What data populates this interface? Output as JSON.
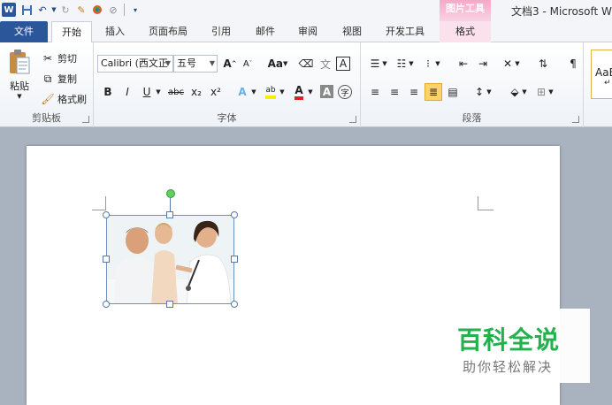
{
  "window": {
    "context_header": "图片工具",
    "title": "文档3 - Microsoft W"
  },
  "qat": {
    "logo": "W",
    "save_icon": "save-icon",
    "undo_icon": "undo-icon",
    "redo_icon": "redo-icon",
    "customize_icon": "customize-icon"
  },
  "tabs": [
    {
      "label": "文件"
    },
    {
      "label": "开始"
    },
    {
      "label": "插入"
    },
    {
      "label": "页面布局"
    },
    {
      "label": "引用"
    },
    {
      "label": "邮件"
    },
    {
      "label": "审阅"
    },
    {
      "label": "视图"
    },
    {
      "label": "开发工具"
    },
    {
      "label": "格式"
    }
  ],
  "clipboard": {
    "label": "剪贴板",
    "paste": "粘贴",
    "cut": "剪切",
    "copy": "复制",
    "painter": "格式刷"
  },
  "font": {
    "label": "字体",
    "font_name": "Calibri (西文正",
    "font_size": "五号",
    "grow": "A",
    "shrink": "A",
    "case": "Aa",
    "bold": "B",
    "italic": "I",
    "underline": "U",
    "strike": "abc",
    "subscript": "x₂",
    "superscript": "x²",
    "phonetic": "文",
    "char_border": "A",
    "char_shading": "A",
    "enclose": "字"
  },
  "paragraph": {
    "label": "段落"
  },
  "styles": {
    "preview": "AaB",
    "preview_sub": "↵"
  },
  "watermark": {
    "main": "百科全说",
    "sub": "助你轻松解决"
  },
  "colors": {
    "accent": "#2b579a",
    "context": "#f5a8c8",
    "watermark_green": "#22b14c"
  }
}
